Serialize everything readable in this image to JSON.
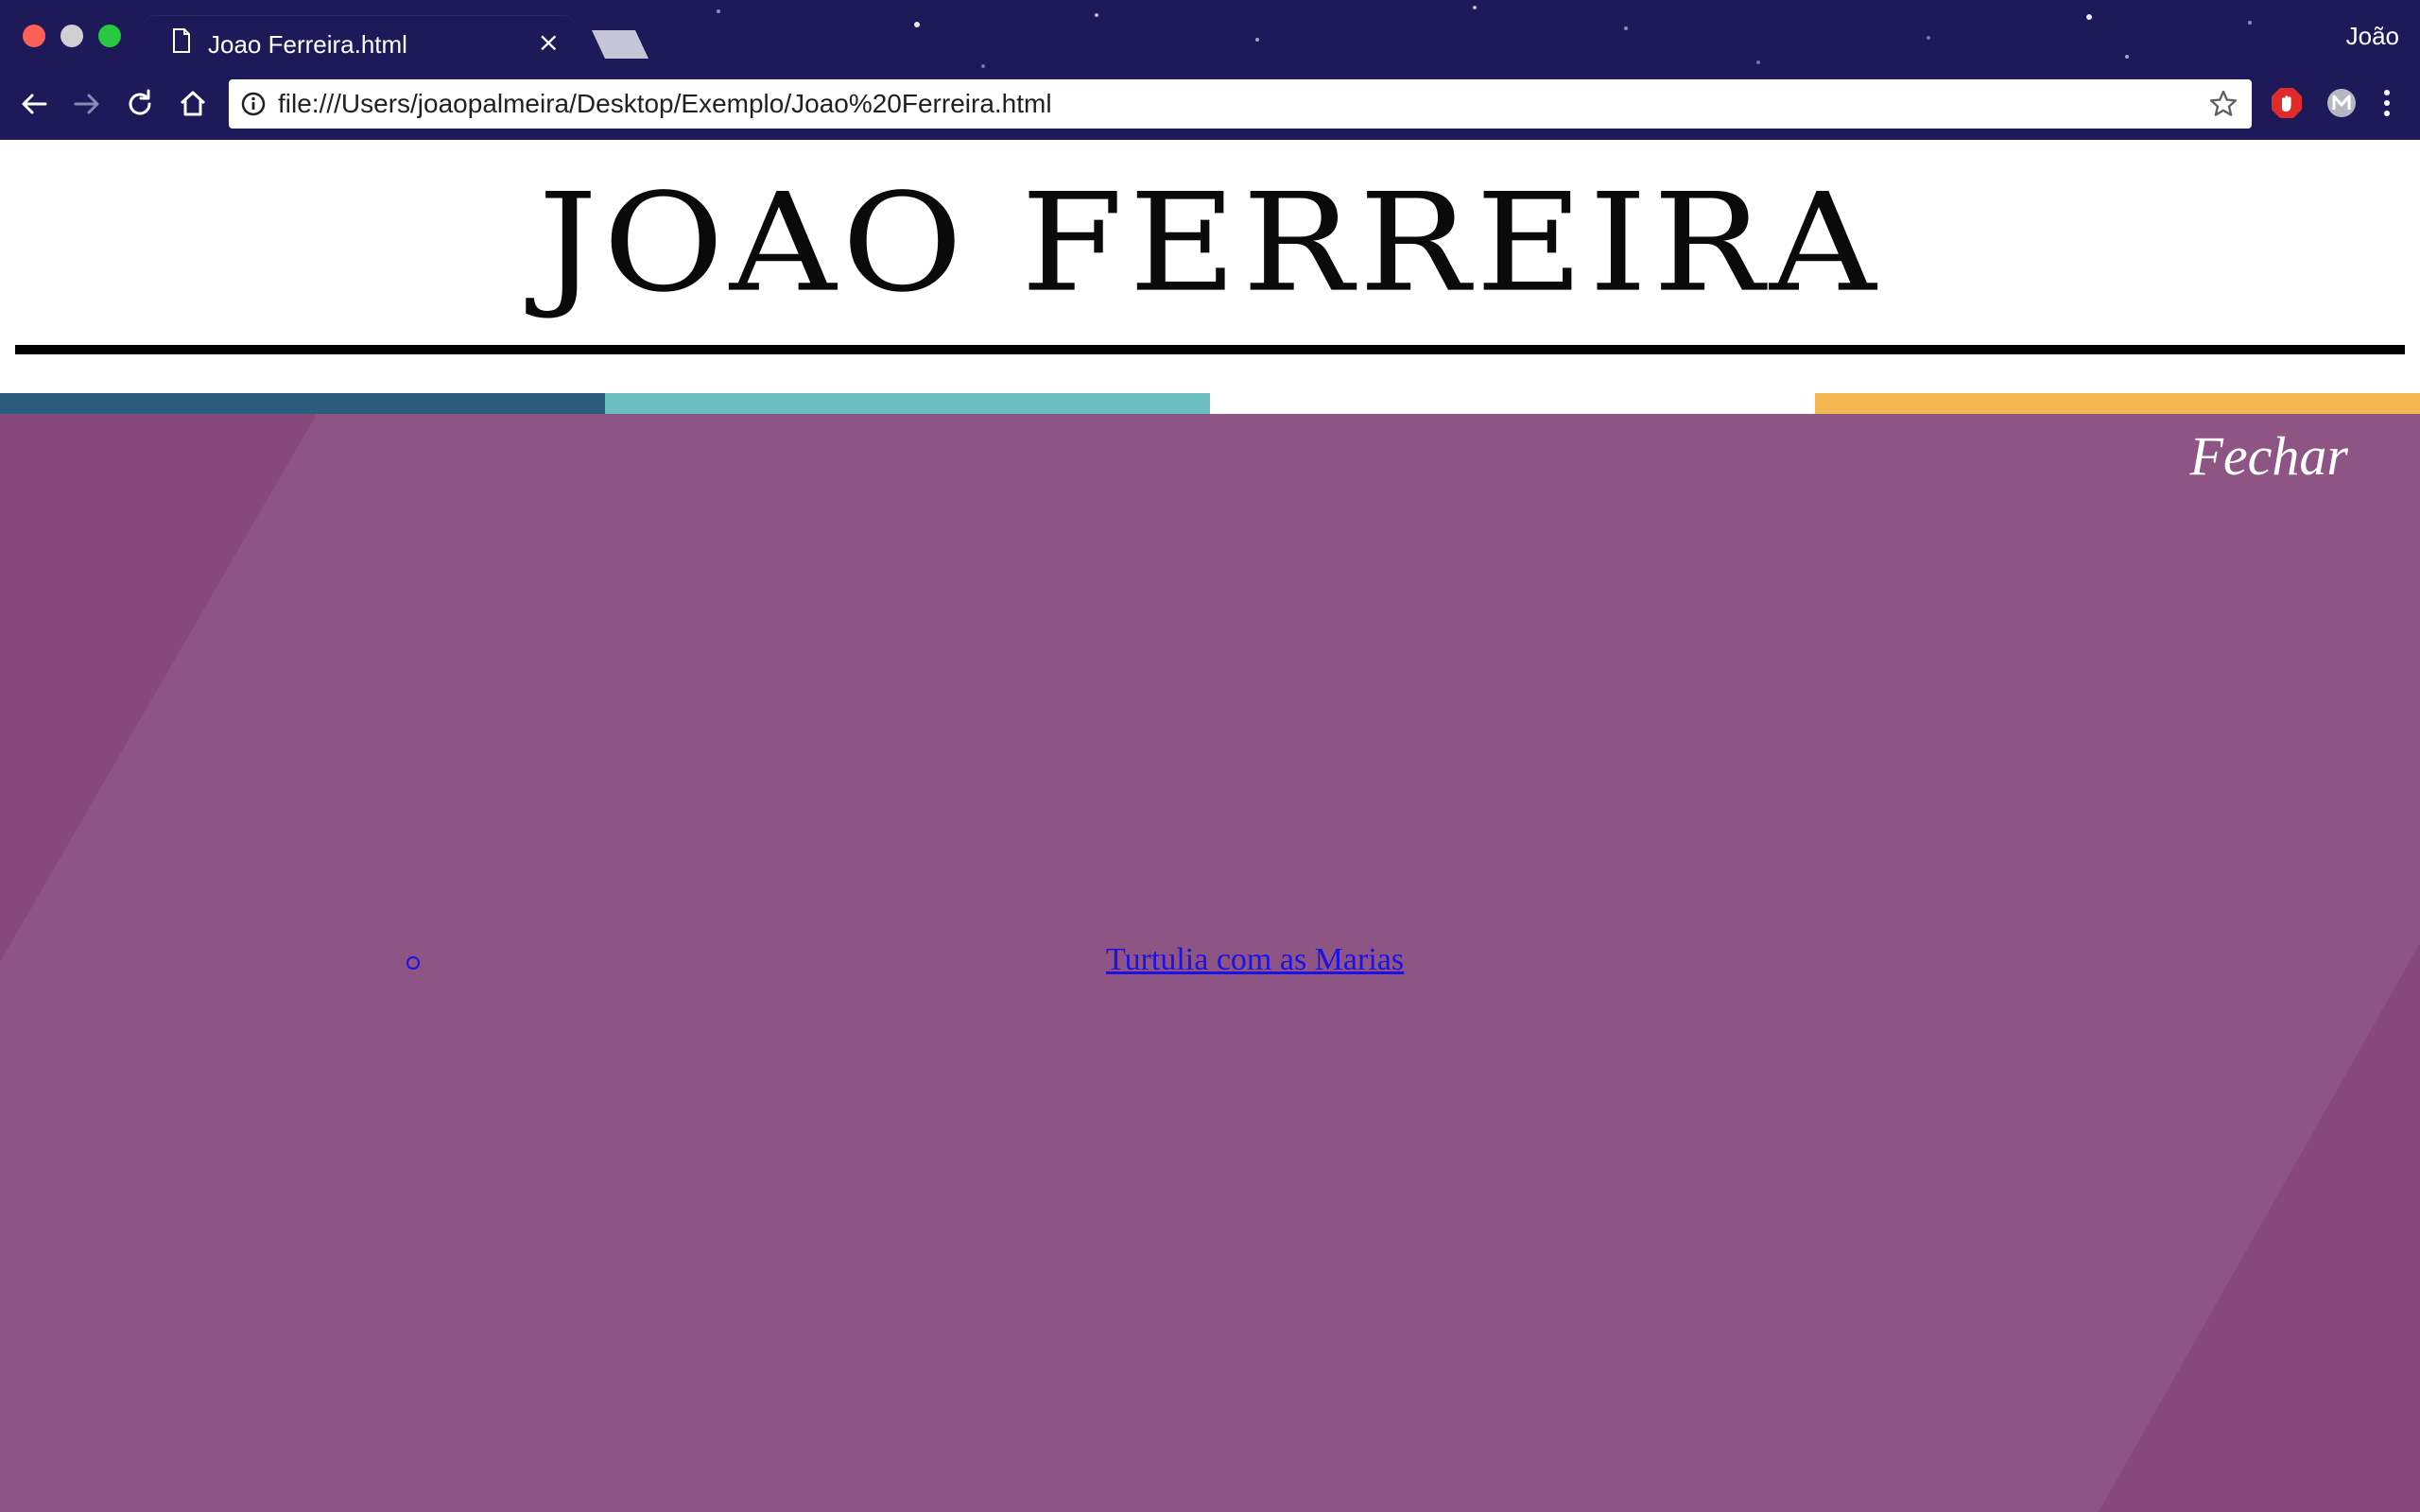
{
  "browser": {
    "tab": {
      "title": "Joao Ferreira.html",
      "close_glyph": "×",
      "icon": "document-icon"
    },
    "profile_name": "João",
    "address_bar": {
      "url": "file:///Users/joaopalmeira/Desktop/Exemplo/Joao%20Ferreira.html",
      "info_icon": "info-icon",
      "bookmark_icon": "star-icon"
    },
    "toolbar_icons": [
      "back-arrow-icon",
      "forward-arrow-icon",
      "reload-icon",
      "home-icon"
    ],
    "extension_icons": [
      "adblock-icon",
      "profile-m-icon",
      "kebab-menu-icon"
    ],
    "colors": {
      "chrome_bg": "#1e1a5a",
      "traffic_red": "#fe5f57",
      "traffic_yellow": "#d0d0d4",
      "traffic_green": "#28c840"
    }
  },
  "page": {
    "site_title": "JOAO FERREIRA",
    "close_label": "Fechar",
    "menu_items": [
      {
        "label": "Turtulia com as Marias"
      }
    ],
    "colors": {
      "overlay_bg": "#8e5483",
      "bar_1": "#2c5b7e",
      "bar_2": "#6bbfbf",
      "bar_3": "#ffffff",
      "bar_4": "#f3b651",
      "link": "#1a12e6"
    }
  }
}
